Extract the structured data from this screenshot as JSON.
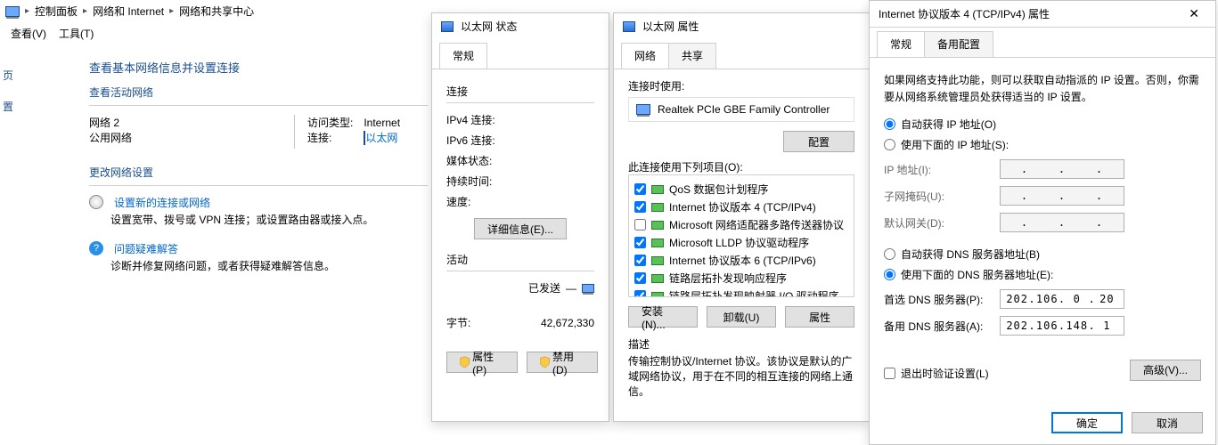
{
  "breadcrumb": {
    "seg1": "控制面板",
    "seg2": "网络和 Internet",
    "seg3": "网络和共享中心"
  },
  "menubar": {
    "view": "查看(V)",
    "tools": "工具(T)"
  },
  "left_rail": {
    "a": "页",
    "b": "置"
  },
  "ncenter": {
    "title": "查看基本网络信息并设置连接",
    "active_net": "查看活动网络",
    "net_name": "网络  2",
    "net_type": "公用网络",
    "access_label": "访问类型:",
    "access_value": "Internet",
    "conn_label": "连接:",
    "conn_value": "以太网",
    "change_header": "更改网络设置",
    "item1_title": "设置新的连接或网络",
    "item1_desc": "设置宽带、拨号或 VPN 连接；或设置路由器或接入点。",
    "item2_title": "问题疑难解答",
    "item2_desc": "诊断并修复网络问题，或者获得疑难解答信息。"
  },
  "status": {
    "title": "以太网 状态",
    "tab": "常规",
    "grp_conn": "连接",
    "ipv4": "IPv4 连接:",
    "ipv6": "IPv6 连接:",
    "media": "媒体状态:",
    "duration": "持续时间:",
    "speed": "速度:",
    "details_btn": "详细信息(E)...",
    "grp_act": "活动",
    "sent": "已发送",
    "bytes_label": "字节:",
    "bytes_sent": "42,672,330",
    "props_btn": "属性(P)",
    "disable_btn": "禁用(D)"
  },
  "eth": {
    "title": "以太网 属性",
    "tab1": "网络",
    "tab2": "共享",
    "connect_using": "连接时使用:",
    "device": "Realtek PCIe GBE Family Controller",
    "config_btn": "配置",
    "uses_items": "此连接使用下列项目(O):",
    "items": [
      {
        "checked": true,
        "label": "QoS 数据包计划程序"
      },
      {
        "checked": true,
        "label": "Internet 协议版本 4 (TCP/IPv4)"
      },
      {
        "checked": false,
        "label": "Microsoft 网络适配器多路传送器协议"
      },
      {
        "checked": true,
        "label": "Microsoft LLDP 协议驱动程序"
      },
      {
        "checked": true,
        "label": "Internet 协议版本 6 (TCP/IPv6)"
      },
      {
        "checked": true,
        "label": "链路层拓扑发现响应程序"
      },
      {
        "checked": true,
        "label": "链路层拓扑发现映射器 I/O 驱动程序"
      }
    ],
    "install_btn": "安装(N)...",
    "uninstall_btn": "卸载(U)",
    "props_btn": "属性",
    "desc_label": "描述",
    "desc_text": "传输控制协议/Internet 协议。该协议是默认的广域网络协议，用于在不同的相互连接的网络上通信。"
  },
  "ip": {
    "title": "Internet 协议版本 4 (TCP/IPv4) 属性",
    "tab1": "常规",
    "tab2": "备用配置",
    "intro": "如果网络支持此功能，则可以获取自动指派的 IP 设置。否则，你需要从网络系统管理员处获得适当的 IP 设置。",
    "auto_ip": "自动获得 IP 地址(O)",
    "manual_ip": "使用下面的 IP 地址(S):",
    "ip_label": "IP 地址(I):",
    "mask_label": "子网掩码(U):",
    "gw_label": "默认网关(D):",
    "auto_dns": "自动获得 DNS 服务器地址(B)",
    "manual_dns": "使用下面的 DNS 服务器地址(E):",
    "dns1_label": "首选 DNS 服务器(P):",
    "dns2_label": "备用 DNS 服务器(A):",
    "dns1": [
      "202",
      "106",
      "0",
      "20"
    ],
    "dns2": [
      "202",
      "106",
      "148",
      "1"
    ],
    "validate": "退出时验证设置(L)",
    "advanced_btn": "高级(V)...",
    "ok": "确定",
    "cancel": "取消"
  }
}
